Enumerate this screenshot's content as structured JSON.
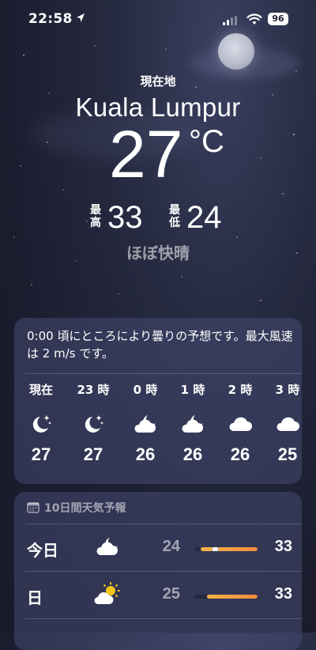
{
  "status_bar": {
    "time": "22:58",
    "battery": "96"
  },
  "location": {
    "label": "現在地",
    "city": "Kuala Lumpur"
  },
  "current": {
    "temperature": "27",
    "unit": "°C",
    "high_label": "最高",
    "high": "33",
    "low_label": "最低",
    "low": "24",
    "condition": "ほぼ快晴"
  },
  "hourly": {
    "summary": "0:00 頃にところにより曇りの予想です。最大風速は 2 m/s です。",
    "items": [
      {
        "label": "現在",
        "icon": "moon-stars-icon",
        "temp": "27"
      },
      {
        "label": "23 時",
        "icon": "moon-stars-icon",
        "temp": "27"
      },
      {
        "label": "0 時",
        "icon": "cloud-moon-icon",
        "temp": "26"
      },
      {
        "label": "1 時",
        "icon": "cloud-moon-icon",
        "temp": "26"
      },
      {
        "label": "2 時",
        "icon": "cloud-icon",
        "temp": "26"
      },
      {
        "label": "3 時",
        "icon": "cloud-icon",
        "temp": "25"
      }
    ]
  },
  "daily": {
    "title": "10日間天気予報",
    "items": [
      {
        "day": "今日",
        "icon": "cloud-moon-icon",
        "low": "24",
        "high": "33",
        "range_start": 0.1,
        "range_end": 1.0,
        "current_marker": 0.33
      },
      {
        "day": "日",
        "icon": "cloud-sun-icon",
        "low": "25",
        "high": "33",
        "range_start": 0.2,
        "range_end": 1.0
      }
    ]
  },
  "colors": {
    "background": "#1b1d2f",
    "card": "#464b73",
    "bar_start": "#f3b447",
    "bar_end": "#f08a3e",
    "sun": "#f5c518"
  }
}
